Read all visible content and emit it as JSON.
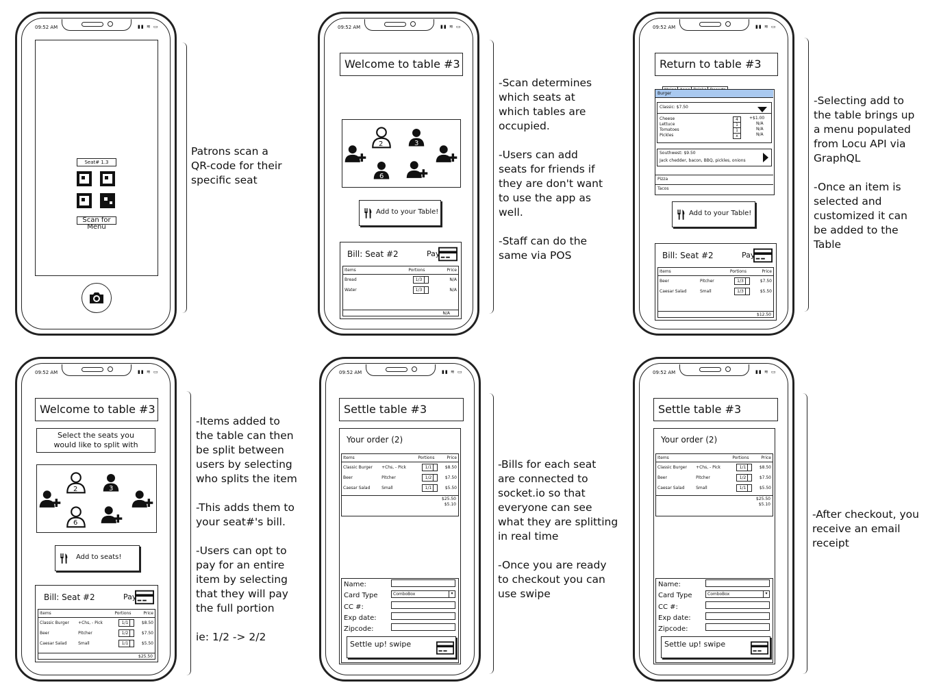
{
  "status": {
    "time": "09:52 AM"
  },
  "screen1": {
    "seat_label": "Seat# 1.3",
    "scan_button": "Scan for Menu",
    "annotation": "Patrons scan a\nQR-code for their\nspecific seat"
  },
  "screen2": {
    "title": "Welcome to table #3",
    "seats": [
      "2",
      "3",
      "6"
    ],
    "add_button": "Add to your Table!",
    "bill_title": "Bill: Seat #2",
    "pay": "Pay",
    "headers": [
      "Items",
      "Portions",
      "Price"
    ],
    "rows": [
      {
        "item": "Bread",
        "portion": "1/3",
        "price": "N/A"
      },
      {
        "item": "Water",
        "portion": "1/3",
        "price": "N/A"
      }
    ],
    "total": "N/A",
    "annotation": "-Scan determines\nwhich seats at\nwhich tables are\noccupied.\n\n-Users can add\nseats for friends if\nthey are don't want\nto use the app as\nwell.\n\n-Staff can do the\nsame via POS"
  },
  "screen3": {
    "title": "Return to table #3",
    "tabs": [
      "Mains",
      "Apps",
      "Drinks",
      "Deserts"
    ],
    "category": "Burger",
    "classic": "Classic: $7.50",
    "toppings": [
      "Cheese",
      "Lettuce",
      "Tomatoes",
      "Pickles"
    ],
    "topping_counts": [
      "4",
      "1",
      "1",
      "x"
    ],
    "topping_prices": [
      "+$1.00",
      "N/A",
      "N/A",
      "N/A"
    ],
    "southwest": "Southwest: $9.50",
    "southwest_desc": "Jack chedder, bacon, BBQ, pickles, onions",
    "pizza": "Pizza",
    "tacos": "Tacos",
    "add_button": "Add to your Table!",
    "bill_title": "Bill: Seat #2",
    "pay": "Pay",
    "headers": [
      "Items",
      "Portions",
      "Price"
    ],
    "rows": [
      {
        "item": "Beer",
        "mod": "Pitcher",
        "portion": "1/3",
        "price": "$7.50"
      },
      {
        "item": "Caesar Salad",
        "mod": "Small",
        "portion": "1/3",
        "price": "$5.50"
      }
    ],
    "total": "$12.50",
    "annotation": "-Selecting add to\nthe table brings up\na menu populated\nfrom Locu API via\nGraphQL\n\n-Once an item is\nselected and\ncustomized it can\nbe added to the\nTable"
  },
  "screen4": {
    "title": "Welcome to table #3",
    "instruction": "Select the seats you\nwould like to split with",
    "seats": [
      "2",
      "3",
      "6"
    ],
    "add_button": "Add to seats!",
    "bill_title": "Bill: Seat #2",
    "pay": "Pay",
    "headers": [
      "Items",
      "Portions",
      "Price"
    ],
    "rows": [
      {
        "item": "Classic Burger",
        "mod": "+Chs, - Pick",
        "portion": "1/1",
        "price": "$8.50"
      },
      {
        "item": "Beer",
        "mod": "Pitcher",
        "portion": "1/2",
        "price": "$7.50"
      },
      {
        "item": "Caesar Salad",
        "mod": "Small",
        "portion": "1/1",
        "price": "$5.50"
      }
    ],
    "total": "$25.50",
    "annotation": "-Items added to\nthe table can then\nbe split between\nusers by selecting\nwho splits the item\n\n-This adds them to\nyour seat#'s bill.\n\n-Users can opt to\npay for an entire\nitem by selecting\nthat they will pay\nthe full portion\n\nie: 1/2 -> 2/2"
  },
  "screen5": {
    "title": "Settle table #3",
    "order": "Your order (2)",
    "headers": [
      "Items",
      "Portions",
      "Price"
    ],
    "rows": [
      {
        "item": "Classic Burger",
        "mod": "+Chs, - Pick",
        "portion": "1/1",
        "price": "$8.50"
      },
      {
        "item": "Beer",
        "mod": "Pitcher",
        "portion": "1/2",
        "price": "$7.50"
      },
      {
        "item": "Caesar Salad",
        "mod": "Small",
        "portion": "1/1",
        "price": "$5.50"
      }
    ],
    "total": "$25.50",
    "subtotal": "$5.10",
    "form": {
      "name": "Name:",
      "card": "Card Type",
      "combo": "ComboBox",
      "cc": "CC #:",
      "exp": "Exp date:",
      "zip": "Zipcode:"
    },
    "settle": "Settle up! swipe",
    "annotation": "-Bills for each seat\nare connected to\nsocket.io so that\neveryone can see\nwhat they are splitting\nin real time\n\n-Once you are ready\nto checkout you can\nuse swipe"
  },
  "screen6": {
    "title": "Settle table #3",
    "order": "Your order (2)",
    "headers": [
      "Items",
      "Portions",
      "Price"
    ],
    "rows": [
      {
        "item": "Classic Burger",
        "mod": "+Chs, - Pick",
        "portion": "1/1",
        "price": "$8.50"
      },
      {
        "item": "Beer",
        "mod": "Pitcher",
        "portion": "1/2",
        "price": "$7.50"
      },
      {
        "item": "Caesar Salad",
        "mod": "Small",
        "portion": "1/1",
        "price": "$5.50"
      }
    ],
    "total": "$25.50",
    "subtotal": "$5.10",
    "form": {
      "name": "Name:",
      "card": "Card Type",
      "combo": "ComboBox",
      "cc": "CC #:",
      "exp": "Exp date:",
      "zip": "Zipcode:"
    },
    "settle": "Settle up! swipe",
    "annotation": "-After checkout, you\nreceive an email\nreceipt"
  }
}
